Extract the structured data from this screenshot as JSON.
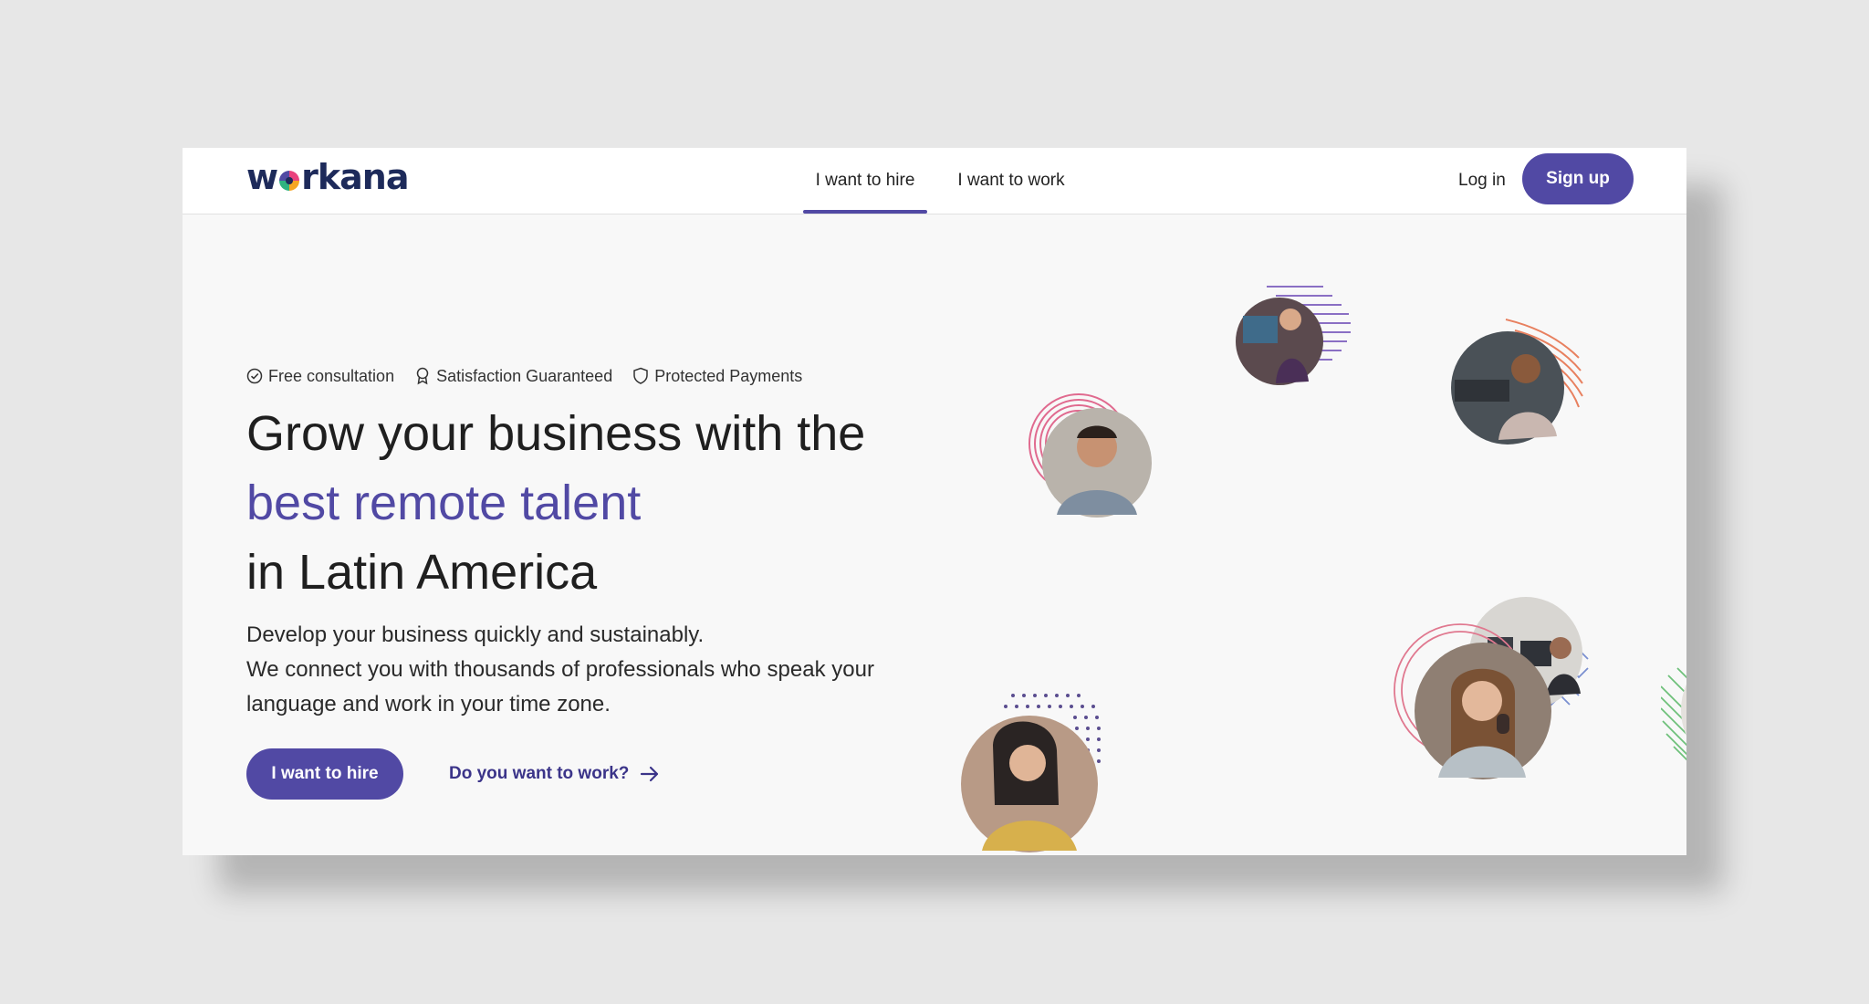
{
  "nav": {
    "logo_prefix": "w",
    "logo_suffix": "rkana",
    "tabs": [
      {
        "label": "I want to hire",
        "active": true
      },
      {
        "label": "I want to work",
        "active": false
      }
    ],
    "login": "Log in",
    "signup": "Sign up"
  },
  "hero": {
    "badges": [
      {
        "icon": "check-circle-icon",
        "label": "Free consultation"
      },
      {
        "icon": "award-icon",
        "label": "Satisfaction Guaranteed"
      },
      {
        "icon": "shield-icon",
        "label": "Protected Payments"
      }
    ],
    "headline_line1": "Grow your business with the",
    "headline_accent": "best remote talent",
    "headline_line3": "in Latin America",
    "description_line1": "Develop your business quickly and sustainably.",
    "description_line2": "We connect you with thousands of professionals who speak your language and work in your time zone.",
    "primary_cta": "I want to hire",
    "secondary_cta": "Do you want to work?"
  },
  "colors": {
    "accent": "#5149a4",
    "logo": "#1d2a5a",
    "background": "#f8f8f8"
  }
}
